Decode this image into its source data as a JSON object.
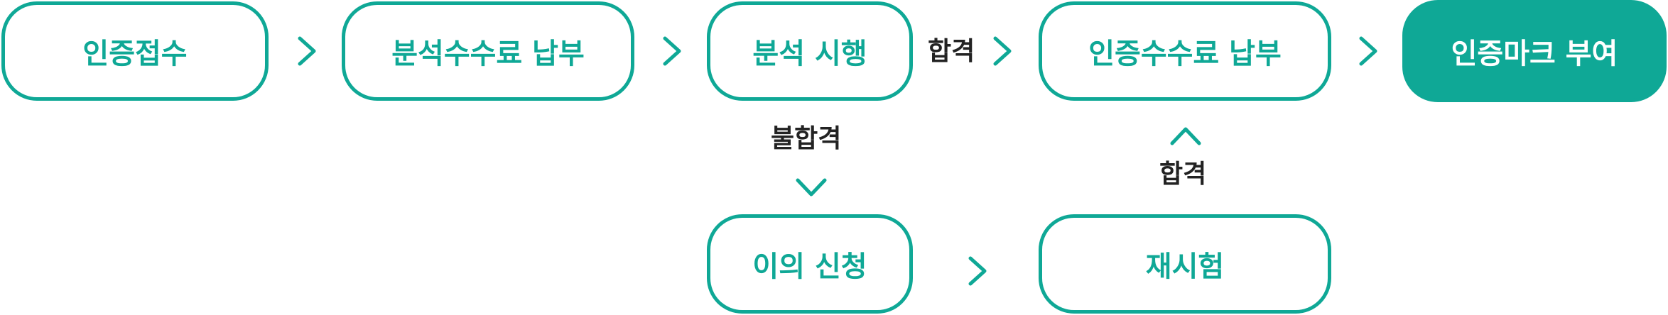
{
  "colors": {
    "accent": "#0FA896",
    "label_text": "#222222",
    "filled_text": "#ffffff"
  },
  "nodes": {
    "certification_application": "인증접수",
    "analysis_fee_payment": "분석수수료 납부",
    "analysis_test": "분석 시행",
    "certification_fee_payment": "인증수수료 납부",
    "certification_mark_grant": "인증마크 부여",
    "appeal_request": "이의 신청",
    "retest": "재시험"
  },
  "labels": {
    "pass_top": "합격",
    "fail": "불합격",
    "pass_retest": "합격"
  },
  "icons": {
    "arrow": "chevron-icon"
  }
}
